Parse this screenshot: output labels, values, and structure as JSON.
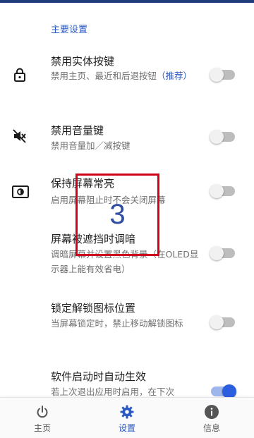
{
  "section_title": "主要设置",
  "settings": [
    {
      "title": "禁用实体按键",
      "desc": "禁用主页、最近和后退按钮",
      "desc_accent": "（推荐）",
      "icon": "lock-icon",
      "enabled": false
    },
    {
      "title": "禁用音量键",
      "desc": "禁用音量加／减按键",
      "icon": "volume-off-icon",
      "enabled": false
    },
    {
      "title": "保持屏幕常亮",
      "desc": "启用屏幕阻止时不会关闭屏幕",
      "icon": "brightness-icon",
      "enabled": false
    },
    {
      "title": "屏幕被遮挡时调暗",
      "desc": "调暗屏幕并设置黑色背景（在OLED显示器上能有效省电）",
      "icon": "",
      "enabled": false
    },
    {
      "title": "锁定解锁图标位置",
      "desc": "当屏幕锁定时，禁止移动解锁图标",
      "icon": "",
      "enabled": false
    },
    {
      "title": "软件启动时自动生效",
      "desc": "若上次退出应用时启用，在下次",
      "icon": "",
      "enabled": true
    }
  ],
  "overlay_marker": "3",
  "bottom_nav": {
    "items": [
      {
        "label": "主页",
        "icon": "power-icon",
        "active": false
      },
      {
        "label": "设置",
        "icon": "gear-icon",
        "active": true
      },
      {
        "label": "信息",
        "icon": "info-icon",
        "active": false
      }
    ]
  },
  "colors": {
    "accent": "#2b59c3",
    "toggle_on": "#2b5fe0",
    "overlay_border": "#d0021b"
  }
}
